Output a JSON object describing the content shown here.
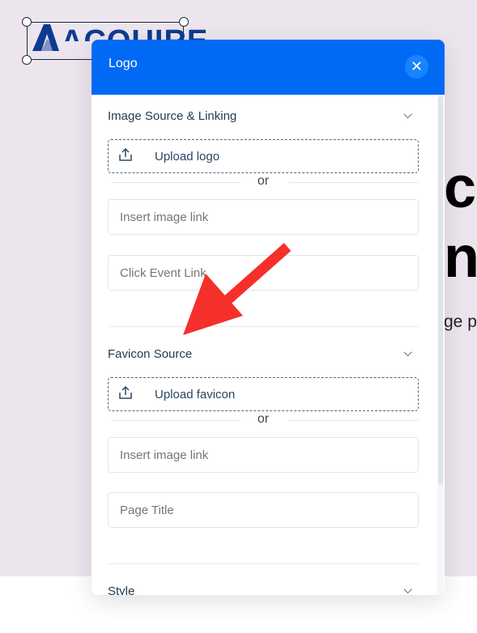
{
  "background": {
    "logo_text": "ACQUIRE",
    "hero_line1": "c",
    "hero_line2": "n",
    "hero_sub": "ge pe"
  },
  "panel": {
    "title": "Logo",
    "close_icon": "close-icon",
    "sections": [
      {
        "title": "Image Source & Linking",
        "upload_label": "Upload logo",
        "or_label": "or",
        "image_link_placeholder": "Insert image link",
        "second_placeholder": "Click Event Link"
      },
      {
        "title": "Favicon Source",
        "upload_label": "Upload favicon",
        "or_label": "or",
        "image_link_placeholder": "Insert image link",
        "second_placeholder": "Page Title"
      },
      {
        "title": "Style"
      }
    ]
  },
  "colors": {
    "header": "#006af5",
    "annotation_arrow": "#f5302a"
  }
}
